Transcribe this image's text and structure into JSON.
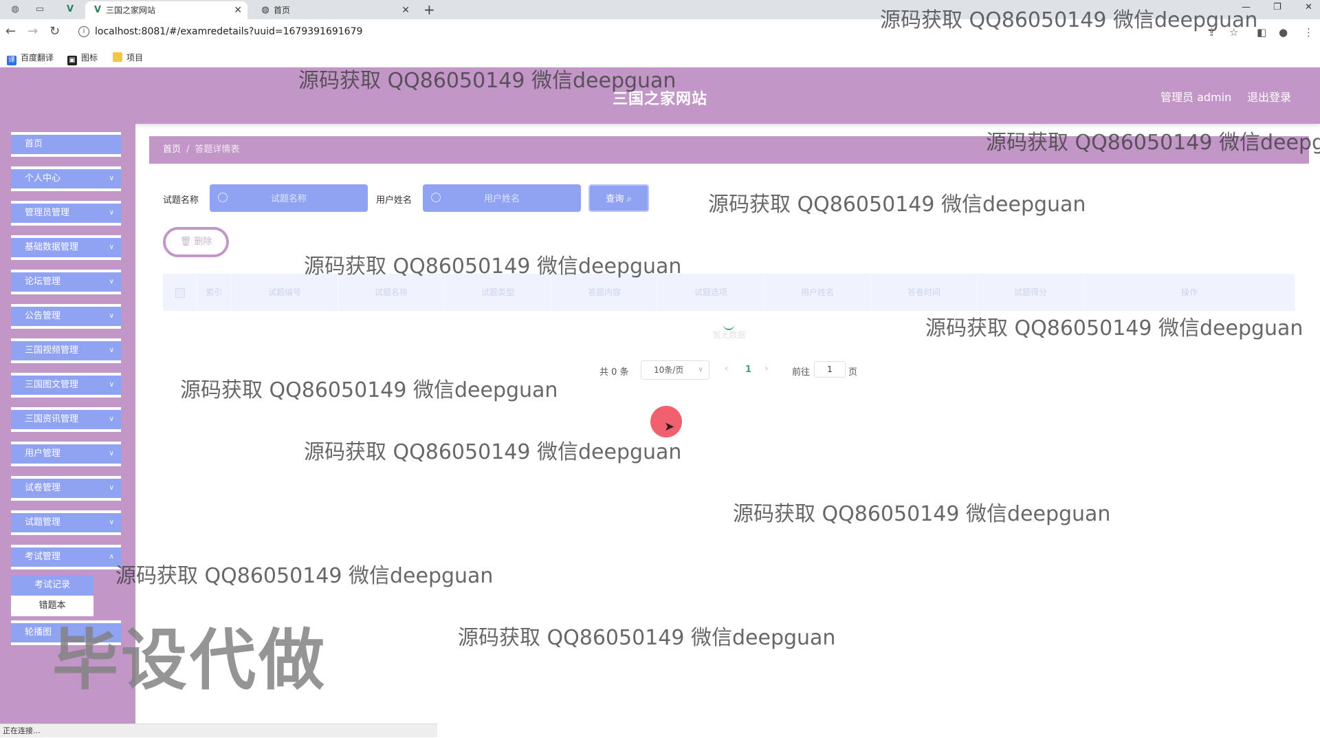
{
  "browser": {
    "tabs": [
      {
        "title": "三国之家网站",
        "active": true
      },
      {
        "title": "首页",
        "active": false
      }
    ],
    "url": "localhost:8081/#/examredetails?uuid=1679391691679",
    "bookmarks": [
      "百度翻译",
      "图标",
      "项目"
    ],
    "status_text": "正在连接..."
  },
  "header": {
    "site_title": "三国之家网站",
    "user_label": "管理员 admin",
    "logout_label": "退出登录"
  },
  "sidebar": {
    "items": [
      {
        "label": "首页",
        "has_children": false
      },
      {
        "label": "个人中心",
        "has_children": true
      },
      {
        "label": "管理员管理",
        "has_children": true
      },
      {
        "label": "基础数据管理",
        "has_children": true
      },
      {
        "label": "论坛管理",
        "has_children": true
      },
      {
        "label": "公告管理",
        "has_children": true
      },
      {
        "label": "三国视频管理",
        "has_children": true
      },
      {
        "label": "三国图文管理",
        "has_children": true
      },
      {
        "label": "三国资讯管理",
        "has_children": true
      },
      {
        "label": "用户管理",
        "has_children": true
      },
      {
        "label": "试卷管理",
        "has_children": true
      },
      {
        "label": "试题管理",
        "has_children": true
      },
      {
        "label": "考试管理",
        "has_children": true
      },
      {
        "label": "轮播图",
        "has_children": false
      }
    ],
    "submenu": [
      "考试记录",
      "错题本"
    ]
  },
  "breadcrumb": {
    "home": "首页",
    "separator": "/",
    "current": "答题详情表"
  },
  "search": {
    "label_question": "试题名称",
    "placeholder_question": "试题名称",
    "label_user": "用户姓名",
    "placeholder_user": "用户姓名",
    "query_button": "查询"
  },
  "actions": {
    "delete_button": "删除"
  },
  "table": {
    "columns": [
      "",
      "索引",
      "试题编号",
      "试题名称",
      "试题类型",
      "答题内容",
      "试题选项",
      "用户姓名",
      "答卷时间",
      "试题得分",
      "操作"
    ],
    "empty_text": "暂无数据"
  },
  "pagination": {
    "total_text": "共 0 条",
    "page_size": "10条/页",
    "current_page": "1",
    "goto_label": "前往",
    "goto_value": "1",
    "page_suffix": "页"
  },
  "watermarks": {
    "text": "源码获取 QQ86050149 微信deepguan",
    "big_text": "毕设代做"
  },
  "colors": {
    "theme_purple": "#c396c8",
    "menu_blue": "#8fa3f2",
    "pagination_active": "#3aa37a"
  }
}
